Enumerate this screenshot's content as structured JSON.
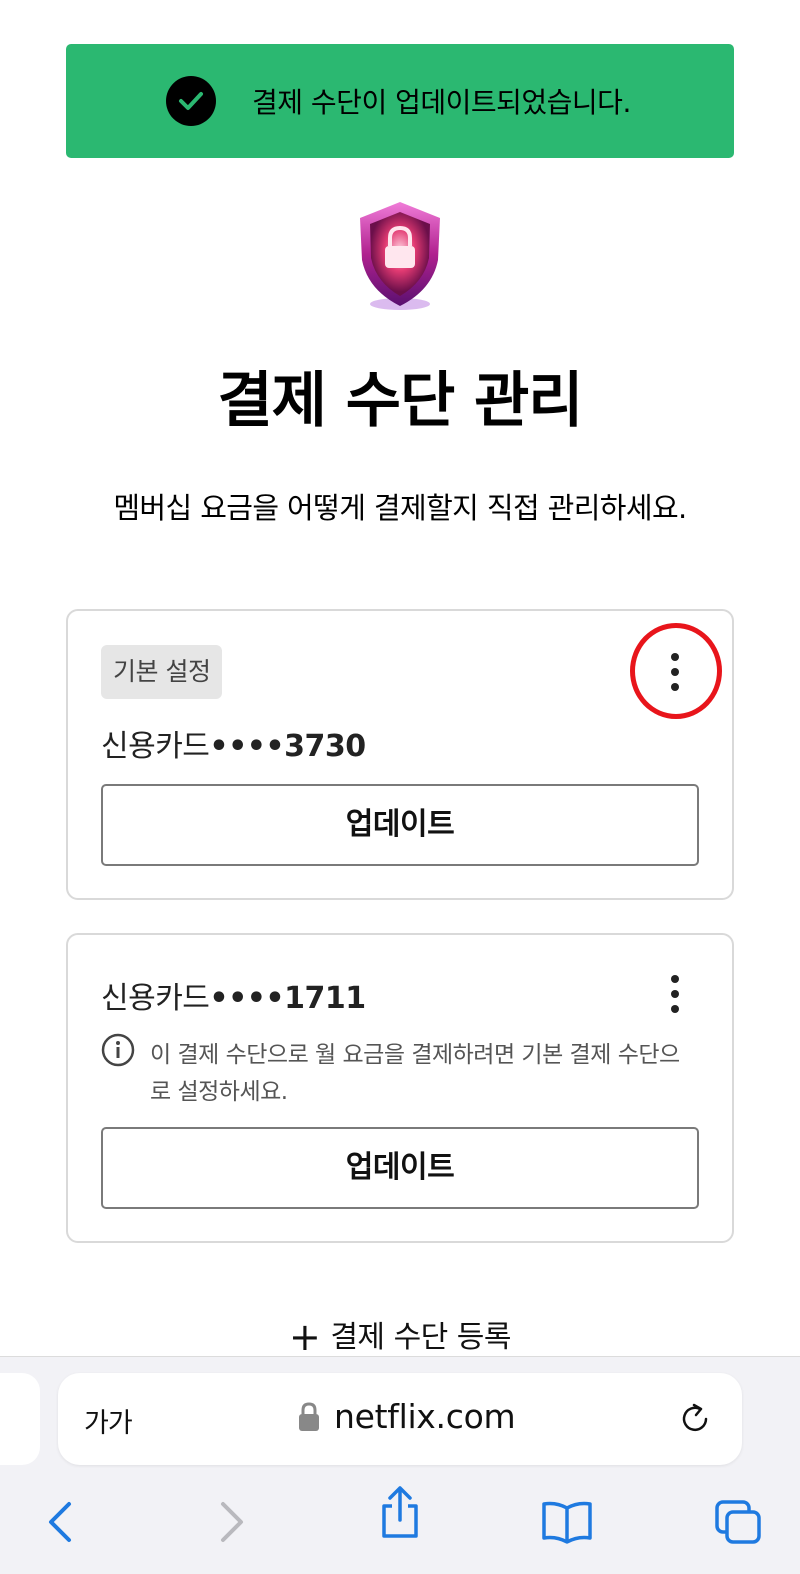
{
  "toast": {
    "message": "결제 수단이 업데이트되었습니다.",
    "icon": "check-icon",
    "color": "#2bb871"
  },
  "header": {
    "title": "결제 수단 관리",
    "subtitle": "멤버십 요금을 어떻게 결제할지 직접 관리하세요."
  },
  "cards": [
    {
      "badge": "기본 설정",
      "label": "신용카드",
      "masked": "••••3730",
      "button": "업데이트"
    },
    {
      "label": "신용카드",
      "masked": "••••1711",
      "info": "이 결제 수단으로 월 요금을 결제하려면 기본 결제 수단으로 설정하세요.",
      "button": "업데이트"
    }
  ],
  "add_payment": {
    "label": "결제 수단 등록"
  },
  "browser": {
    "text_size": "가가",
    "domain": "netflix.com"
  },
  "colors": {
    "accent": "#2bb871",
    "highlight_ring": "#e8151b",
    "ios_blue": "#1f7ae0"
  }
}
